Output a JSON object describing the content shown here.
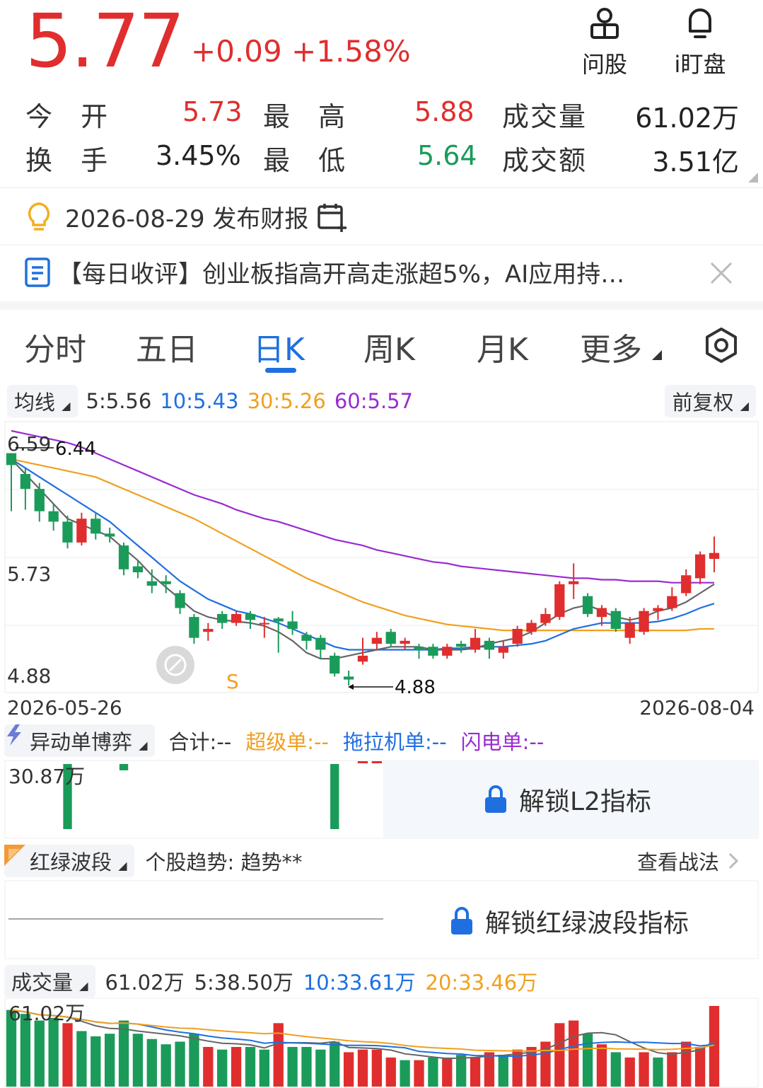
{
  "quote": {
    "price": "5.77",
    "change": "+0.09",
    "change_pct": "+1.58%"
  },
  "top_buttons": [
    {
      "label": "问股",
      "icon": "user-stock-icon"
    },
    {
      "label": "i盯盘",
      "icon": "bell-icon"
    }
  ],
  "stats": {
    "open_label": "今 开",
    "open": "5.73",
    "high_label": "最 高",
    "high": "5.88",
    "volume_label": "成交量",
    "volume": "61.02万",
    "turnover_label": "换 手",
    "turnover": "3.45%",
    "low_label": "最 低",
    "low": "5.64",
    "amount_label": "成交额",
    "amount": "3.51亿"
  },
  "report": {
    "text": "2026-08-29 发布财报"
  },
  "news": {
    "text": "【每日收评】创业板指高开高走涨超5%，AI应用持…"
  },
  "tabs": [
    "分时",
    "五日",
    "日K",
    "周K",
    "月K",
    "更多"
  ],
  "active_tab": "日K",
  "ma": {
    "selector": "均线",
    "ma5": "5:5.56",
    "ma10": "10:5.43",
    "ma30": "30:5.26",
    "ma60": "60:5.57",
    "adjust": "前复权"
  },
  "price_axis": {
    "top": "6.59",
    "mid": "5.73",
    "bottom": "4.88",
    "high_mark": "6.44",
    "low_mark": "4.88",
    "start_date": "2026-05-26",
    "end_date": "2026-08-04",
    "signal": "S"
  },
  "flow": {
    "selector": "异动单博弈",
    "total": "合计:--",
    "super": "超级单:--",
    "tractor": "拖拉机单:--",
    "flash": "闪电单:--",
    "axis_max": "30.87万",
    "unlock": "解锁L2指标"
  },
  "wave": {
    "selector": "红绿波段",
    "trend": "个股趋势: 趋势**",
    "view": "查看战法",
    "unlock": "解锁红绿波段指标"
  },
  "vol": {
    "selector": "成交量",
    "total": "61.02万",
    "ma5": "5:38.50万",
    "ma10": "10:33.61万",
    "ma20": "20:33.46万",
    "axis_max": "61.02万"
  },
  "colors": {
    "up": "#e02e2e",
    "down": "#1a9b5a",
    "ma5": "#666666",
    "ma10": "#1f6fe0",
    "ma30": "#f0a020",
    "ma60": "#9a2bd0"
  },
  "chart_data": {
    "type": "candlestick",
    "x_range": [
      "2026-05-26",
      "2026-08-04"
    ],
    "ylim": [
      4.88,
      6.59
    ],
    "candles": [
      {
        "o": 6.44,
        "c": 6.36,
        "h": 6.44,
        "l": 6.05
      },
      {
        "o": 6.3,
        "c": 6.2,
        "h": 6.34,
        "l": 6.06
      },
      {
        "o": 6.2,
        "c": 6.05,
        "h": 6.24,
        "l": 5.98
      },
      {
        "o": 6.05,
        "c": 5.98,
        "h": 6.1,
        "l": 5.92
      },
      {
        "o": 5.98,
        "c": 5.84,
        "h": 6.02,
        "l": 5.8
      },
      {
        "o": 5.84,
        "c": 6.0,
        "h": 6.04,
        "l": 5.82
      },
      {
        "o": 6.0,
        "c": 5.9,
        "h": 6.04,
        "l": 5.86
      },
      {
        "o": 5.9,
        "c": 5.88,
        "h": 5.94,
        "l": 5.84
      },
      {
        "o": 5.82,
        "c": 5.66,
        "h": 5.84,
        "l": 5.62
      },
      {
        "o": 5.68,
        "c": 5.64,
        "h": 5.72,
        "l": 5.6
      },
      {
        "o": 5.58,
        "c": 5.55,
        "h": 5.66,
        "l": 5.5
      },
      {
        "o": 5.58,
        "c": 5.56,
        "h": 5.62,
        "l": 5.5
      },
      {
        "o": 5.5,
        "c": 5.4,
        "h": 5.52,
        "l": 5.36
      },
      {
        "o": 5.34,
        "c": 5.2,
        "h": 5.36,
        "l": 5.16
      },
      {
        "o": 5.24,
        "c": 5.26,
        "h": 5.3,
        "l": 5.18
      },
      {
        "o": 5.36,
        "c": 5.3,
        "h": 5.38,
        "l": 5.26
      },
      {
        "o": 5.3,
        "c": 5.36,
        "h": 5.38,
        "l": 5.28
      },
      {
        "o": 5.36,
        "c": 5.32,
        "h": 5.38,
        "l": 5.26
      },
      {
        "o": 5.3,
        "c": 5.3,
        "h": 5.34,
        "l": 5.2
      },
      {
        "o": 5.33,
        "c": 5.31,
        "h": 5.34,
        "l": 5.1
      },
      {
        "o": 5.31,
        "c": 5.26,
        "h": 5.38,
        "l": 5.22
      },
      {
        "o": 5.22,
        "c": 5.18,
        "h": 5.24,
        "l": 5.12
      },
      {
        "o": 5.2,
        "c": 5.12,
        "h": 5.22,
        "l": 5.06
      },
      {
        "o": 5.08,
        "c": 4.96,
        "h": 5.1,
        "l": 4.94
      },
      {
        "o": 4.94,
        "c": 4.92,
        "h": 4.98,
        "l": 4.88
      },
      {
        "o": 5.04,
        "c": 5.08,
        "h": 5.2,
        "l": 5.02
      },
      {
        "o": 5.16,
        "c": 5.2,
        "h": 5.24,
        "l": 5.12
      },
      {
        "o": 5.24,
        "c": 5.16,
        "h": 5.26,
        "l": 5.14
      },
      {
        "o": 5.16,
        "c": 5.18,
        "h": 5.2,
        "l": 5.12
      },
      {
        "o": 5.14,
        "c": 5.12,
        "h": 5.16,
        "l": 5.06
      },
      {
        "o": 5.14,
        "c": 5.08,
        "h": 5.16,
        "l": 5.06
      },
      {
        "o": 5.08,
        "c": 5.14,
        "h": 5.16,
        "l": 5.06
      },
      {
        "o": 5.16,
        "c": 5.14,
        "h": 5.18,
        "l": 5.1
      },
      {
        "o": 5.12,
        "c": 5.2,
        "h": 5.26,
        "l": 5.1
      },
      {
        "o": 5.18,
        "c": 5.12,
        "h": 5.2,
        "l": 5.06
      },
      {
        "o": 5.1,
        "c": 5.14,
        "h": 5.18,
        "l": 5.06
      },
      {
        "o": 5.16,
        "c": 5.26,
        "h": 5.28,
        "l": 5.14
      },
      {
        "o": 5.24,
        "c": 5.3,
        "h": 5.32,
        "l": 5.22
      },
      {
        "o": 5.3,
        "c": 5.36,
        "h": 5.4,
        "l": 5.28
      },
      {
        "o": 5.34,
        "c": 5.56,
        "h": 5.58,
        "l": 5.32
      },
      {
        "o": 5.56,
        "c": 5.58,
        "h": 5.7,
        "l": 5.46
      },
      {
        "o": 5.48,
        "c": 5.36,
        "h": 5.5,
        "l": 5.34
      },
      {
        "o": 5.34,
        "c": 5.4,
        "h": 5.42,
        "l": 5.28
      },
      {
        "o": 5.38,
        "c": 5.26,
        "h": 5.4,
        "l": 5.24
      },
      {
        "o": 5.2,
        "c": 5.3,
        "h": 5.34,
        "l": 5.16
      },
      {
        "o": 5.24,
        "c": 5.38,
        "h": 5.4,
        "l": 5.22
      },
      {
        "o": 5.38,
        "c": 5.4,
        "h": 5.42,
        "l": 5.32
      },
      {
        "o": 5.4,
        "c": 5.48,
        "h": 5.54,
        "l": 5.38
      },
      {
        "o": 5.5,
        "c": 5.62,
        "h": 5.66,
        "l": 5.48
      },
      {
        "o": 5.6,
        "c": 5.76,
        "h": 5.78,
        "l": 5.56
      },
      {
        "o": 5.73,
        "c": 5.77,
        "h": 5.88,
        "l": 5.64
      }
    ],
    "ma60": [
      6.59,
      6.57,
      6.55,
      6.53,
      6.51,
      6.48,
      6.44,
      6.4,
      6.36,
      6.32,
      6.28,
      6.24,
      6.2,
      6.16,
      6.13,
      6.1,
      6.06,
      6.03,
      6.0,
      5.98,
      5.95,
      5.92,
      5.89,
      5.86,
      5.84,
      5.82,
      5.79,
      5.77,
      5.75,
      5.73,
      5.71,
      5.7,
      5.68,
      5.67,
      5.66,
      5.65,
      5.64,
      5.63,
      5.62,
      5.61,
      5.6,
      5.6,
      5.59,
      5.59,
      5.58,
      5.58,
      5.58,
      5.57,
      5.57,
      5.57,
      5.57
    ],
    "ma30": [
      6.4,
      6.38,
      6.36,
      6.34,
      6.32,
      6.3,
      6.28,
      6.24,
      6.2,
      6.16,
      6.12,
      6.08,
      6.04,
      6.0,
      5.95,
      5.9,
      5.85,
      5.8,
      5.75,
      5.7,
      5.65,
      5.6,
      5.56,
      5.52,
      5.48,
      5.44,
      5.41,
      5.38,
      5.35,
      5.33,
      5.31,
      5.29,
      5.28,
      5.27,
      5.26,
      5.25,
      5.25,
      5.25,
      5.25,
      5.25,
      5.25,
      5.25,
      5.25,
      5.25,
      5.25,
      5.25,
      5.25,
      5.25,
      5.25,
      5.26,
      5.26
    ],
    "ma10": [
      6.4,
      6.34,
      6.28,
      6.22,
      6.16,
      6.1,
      6.04,
      5.98,
      5.9,
      5.82,
      5.74,
      5.66,
      5.58,
      5.52,
      5.46,
      5.42,
      5.38,
      5.36,
      5.33,
      5.3,
      5.26,
      5.22,
      5.18,
      5.14,
      5.12,
      5.12,
      5.12,
      5.12,
      5.12,
      5.12,
      5.12,
      5.13,
      5.13,
      5.14,
      5.14,
      5.14,
      5.15,
      5.16,
      5.18,
      5.22,
      5.26,
      5.28,
      5.3,
      5.3,
      5.3,
      5.3,
      5.31,
      5.33,
      5.36,
      5.4,
      5.43
    ],
    "ma5": [
      6.4,
      6.3,
      6.2,
      6.1,
      6.0,
      5.96,
      5.92,
      5.88,
      5.8,
      5.72,
      5.62,
      5.54,
      5.46,
      5.38,
      5.34,
      5.32,
      5.31,
      5.3,
      5.28,
      5.24,
      5.18,
      5.1,
      5.06,
      5.06,
      5.08,
      5.1,
      5.12,
      5.14,
      5.14,
      5.14,
      5.12,
      5.12,
      5.12,
      5.13,
      5.16,
      5.18,
      5.2,
      5.24,
      5.3,
      5.36,
      5.4,
      5.42,
      5.38,
      5.34,
      5.32,
      5.34,
      5.38,
      5.4,
      5.44,
      5.5,
      5.56
    ],
    "flow_bars": [
      {
        "i": 4,
        "v": 30.87,
        "dir": "down"
      },
      {
        "i": 8,
        "v": 3,
        "dir": "down"
      },
      {
        "i": 23,
        "v": 30.87,
        "dir": "down"
      },
      {
        "i": 25,
        "v": 1,
        "dir": "up"
      },
      {
        "i": 26,
        "v": 1,
        "dir": "up"
      }
    ],
    "volume": [
      {
        "v": 58,
        "up": false
      },
      {
        "v": 55,
        "up": false
      },
      {
        "v": 50,
        "up": false
      },
      {
        "v": 52,
        "up": false
      },
      {
        "v": 48,
        "up": true
      },
      {
        "v": 42,
        "up": false
      },
      {
        "v": 38,
        "up": false
      },
      {
        "v": 40,
        "up": false
      },
      {
        "v": 50,
        "up": false
      },
      {
        "v": 40,
        "up": false
      },
      {
        "v": 36,
        "up": false
      },
      {
        "v": 32,
        "up": false
      },
      {
        "v": 34,
        "up": false
      },
      {
        "v": 40,
        "up": false
      },
      {
        "v": 30,
        "up": true
      },
      {
        "v": 28,
        "up": false
      },
      {
        "v": 30,
        "up": true
      },
      {
        "v": 30,
        "up": false
      },
      {
        "v": 28,
        "up": false
      },
      {
        "v": 48,
        "up": true
      },
      {
        "v": 30,
        "up": false
      },
      {
        "v": 30,
        "up": false
      },
      {
        "v": 28,
        "up": false
      },
      {
        "v": 34,
        "up": false
      },
      {
        "v": 26,
        "up": true
      },
      {
        "v": 28,
        "up": true
      },
      {
        "v": 28,
        "up": true
      },
      {
        "v": 22,
        "up": true
      },
      {
        "v": 20,
        "up": false
      },
      {
        "v": 20,
        "up": true
      },
      {
        "v": 22,
        "up": false
      },
      {
        "v": 22,
        "up": true
      },
      {
        "v": 24,
        "up": false
      },
      {
        "v": 22,
        "up": true
      },
      {
        "v": 26,
        "up": true
      },
      {
        "v": 24,
        "up": false
      },
      {
        "v": 28,
        "up": true
      },
      {
        "v": 30,
        "up": true
      },
      {
        "v": 34,
        "up": true
      },
      {
        "v": 48,
        "up": true
      },
      {
        "v": 50,
        "up": true
      },
      {
        "v": 40,
        "up": false
      },
      {
        "v": 32,
        "up": true
      },
      {
        "v": 26,
        "up": false
      },
      {
        "v": 22,
        "up": true
      },
      {
        "v": 26,
        "up": true
      },
      {
        "v": 22,
        "up": false
      },
      {
        "v": 26,
        "up": true
      },
      {
        "v": 34,
        "up": true
      },
      {
        "v": 30,
        "up": true
      },
      {
        "v": 61.02,
        "up": true
      }
    ]
  }
}
